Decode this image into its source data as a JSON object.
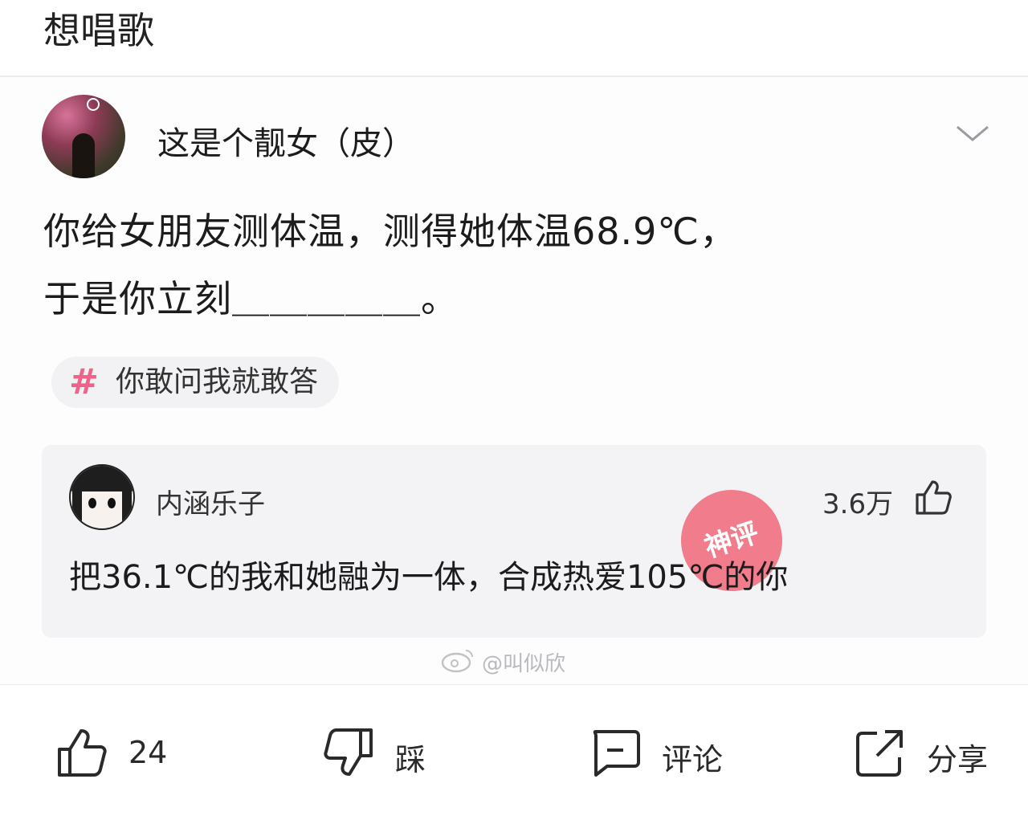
{
  "header": {
    "title": "想唱歌"
  },
  "post": {
    "author": "这是个靓女（皮）",
    "text_line1": "你给女朋友测体温，测得她体温68.9℃，",
    "text_line2": "于是你立刻＿＿＿＿＿。",
    "tag": {
      "symbol": "#",
      "label": "你敢问我就敢答"
    }
  },
  "comment": {
    "author": "内涵乐子",
    "likes": "3.6万",
    "text": "把36.1℃的我和她融为一体，合成热爱105℃的你",
    "stamp_text": "神评"
  },
  "watermark": "@叫似欣",
  "actions": {
    "like": "24",
    "dislike": "踩",
    "comment": "评论",
    "share": "分享"
  },
  "icons": [
    "avatar",
    "chevron-down-icon",
    "hashtag-icon",
    "thumbs-up-icon",
    "thumbs-down-icon",
    "comment-icon",
    "share-icon",
    "weibo-icon"
  ],
  "colors": {
    "tag_hash": "#f06287",
    "stamp": "#f05a6e"
  }
}
